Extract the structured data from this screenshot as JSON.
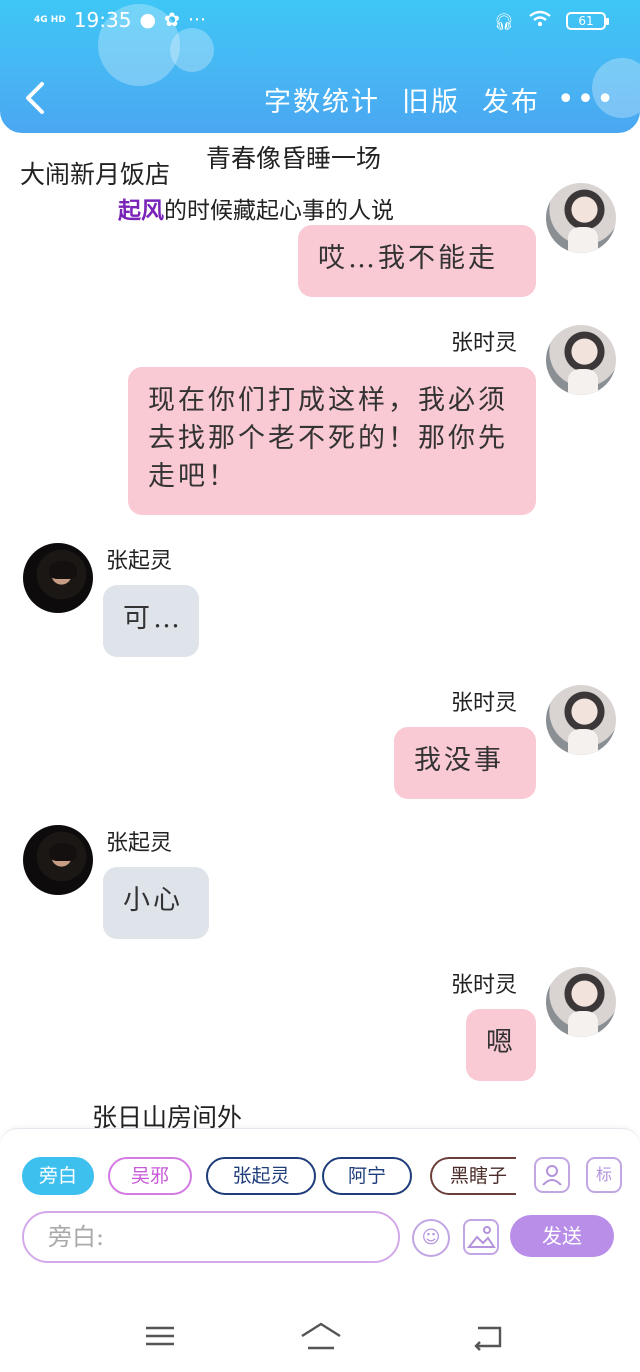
{
  "status_bar": {
    "network": "4G HD",
    "time": "19:35",
    "battery": "61"
  },
  "header": {
    "actions": [
      "字数统计",
      "旧版",
      "发布"
    ],
    "more": "•••"
  },
  "chat": {
    "scene_top": "大闹新月饭店",
    "song_title": "青春像昏睡一场",
    "lyric_highlight": "起风",
    "lyric_rest": "的时候藏起心事的人说",
    "messages": [
      {
        "side": "right",
        "name": "",
        "text": "哎…我不能走"
      },
      {
        "side": "right",
        "name": "张时灵",
        "text": "现在你们打成这样，我必须去找那个老不死的！那你先走吧！"
      },
      {
        "side": "left",
        "name": "张起灵",
        "text": "可…"
      },
      {
        "side": "right",
        "name": "张时灵",
        "text": "我没事"
      },
      {
        "side": "left",
        "name": "张起灵",
        "text": "小心"
      },
      {
        "side": "right",
        "name": "张时灵",
        "text": "嗯"
      }
    ],
    "scene_bottom": "张日山房间外"
  },
  "composer": {
    "roles": [
      "旁白",
      "吴邪",
      "张起灵",
      "阿宁",
      "黑瞎子"
    ],
    "tool_tag": "标",
    "input_placeholder": "旁白:",
    "send_label": "发送"
  },
  "colors": {
    "header": "#47b6f3",
    "right_bubble": "#f9c9d4",
    "left_bubble": "#dfe3ea",
    "send_button": "#b98ee8",
    "active_chip": "#3ec0ef"
  }
}
